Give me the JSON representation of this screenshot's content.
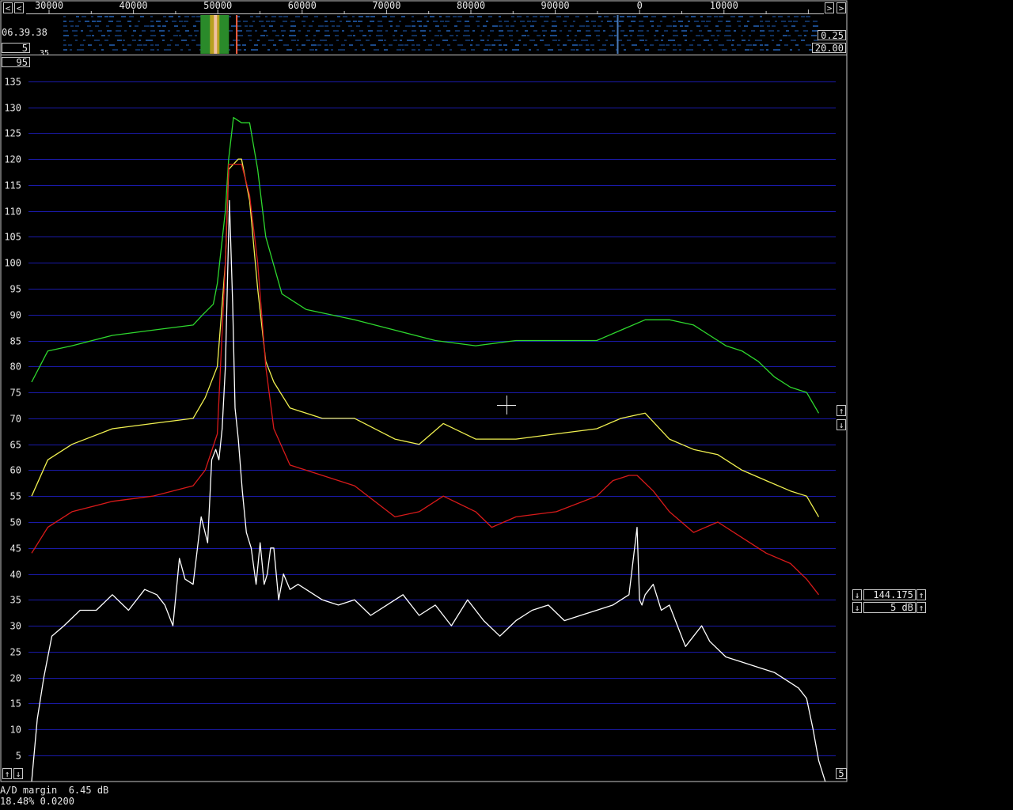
{
  "ruler": {
    "labels": [
      "30000",
      "40000",
      "50000",
      "60000",
      "70000",
      "80000",
      "90000",
      "0",
      "10000"
    ],
    "left_arrow": "<",
    "right_arrow": ">",
    "corner_arrow": ">"
  },
  "waterfall": {
    "time": "06.39.38",
    "avg": "5",
    "truncated_label": "35",
    "gain": "0.25",
    "zero": "20.00"
  },
  "main": {
    "top_value": "95",
    "up_arrow": "↑",
    "down_arrow": "↓",
    "bottom_right_value": "5"
  },
  "freq_panel": {
    "frequency": "144.175",
    "db_per_div": "5 dB",
    "down_arrow": "↓",
    "up_arrow": "↑"
  },
  "status": {
    "line1": "A/D margin  6.45 dB",
    "line2": "18.48% 0.0200"
  },
  "colors": {
    "grid": "#1a1aa8",
    "green_trace": "#2ed82e",
    "yellow_trace": "#f0f050",
    "red_trace": "#d81a1a",
    "white_trace": "#ffffff",
    "background": "#000000"
  },
  "chart_data": {
    "type": "line",
    "y_tick_labels": [
      "135",
      "130",
      "125",
      "120",
      "115",
      "110",
      "105",
      "100",
      "95",
      "90",
      "85",
      "80",
      "75",
      "70",
      "65",
      "60",
      "55",
      "50",
      "45",
      "40",
      "35",
      "30",
      "25",
      "20",
      "15",
      "10",
      "5"
    ],
    "ylim": [
      0,
      138
    ],
    "x_tick_labels": [
      "30000",
      "40000",
      "50000",
      "60000",
      "70000",
      "80000",
      "90000",
      "0",
      "10000"
    ],
    "grid": true,
    "series": [
      {
        "color": "green",
        "x": [
          0,
          2,
          5,
          10,
          15,
          20,
          21.2,
          22.5,
          23,
          24,
          24.4,
          25,
          26,
          27,
          28,
          29,
          31,
          34,
          37,
          40,
          45,
          50,
          55,
          60,
          65,
          70,
          73,
          76,
          79,
          82,
          84,
          86,
          88,
          90,
          92,
          94,
          96,
          97.5
        ],
        "y": [
          77,
          83,
          84,
          86,
          87,
          88,
          90,
          92,
          96,
          110,
          120,
          128,
          127,
          127,
          118,
          105,
          94,
          91,
          90,
          89,
          87,
          85,
          84,
          85,
          85,
          85,
          87,
          89,
          89,
          88,
          86,
          84,
          83,
          81,
          78,
          76,
          75,
          71
        ]
      },
      {
        "color": "yellow",
        "x": [
          0,
          2,
          5,
          10,
          15,
          20,
          21.5,
          23,
          24,
          24.4,
          25.6,
          26,
          27,
          28,
          29,
          30,
          32,
          36,
          40,
          45,
          48,
          51,
          55,
          60,
          65,
          70,
          73,
          76,
          79,
          82,
          85,
          88,
          91,
          94,
          96,
          97.5
        ],
        "y": [
          55,
          62,
          65,
          68,
          69,
          70,
          74,
          80,
          100,
          118,
          120,
          120,
          112,
          95,
          81,
          77,
          72,
          70,
          70,
          66,
          65,
          69,
          66,
          66,
          67,
          68,
          70,
          71,
          66,
          64,
          63,
          60,
          58,
          56,
          55,
          51
        ]
      },
      {
        "color": "red",
        "x": [
          0,
          2,
          5,
          10,
          15,
          20,
          21.5,
          23,
          24,
          24.4,
          26,
          27,
          28,
          29,
          30,
          32,
          36,
          40,
          45,
          48,
          51,
          55,
          57,
          60,
          65,
          70,
          72,
          74,
          75,
          77,
          79,
          82,
          85,
          88,
          91,
          94,
          96,
          97.5
        ],
        "y": [
          44,
          49,
          52,
          54,
          55,
          57,
          60,
          67,
          100,
          119,
          119,
          113,
          100,
          80,
          68,
          61,
          59,
          57,
          51,
          52,
          55,
          52,
          49,
          51,
          52,
          55,
          58,
          59,
          59,
          56,
          52,
          48,
          50,
          47,
          44,
          42,
          39,
          36
        ]
      },
      {
        "color": "white",
        "x": [
          0,
          0.7,
          1.5,
          2.5,
          4,
          6,
          8,
          10,
          12,
          14,
          15.5,
          16.5,
          17.5,
          18.3,
          19,
          20,
          21,
          21.8,
          22.3,
          22.8,
          23.2,
          23.6,
          24,
          24.5,
          24.9,
          25.2,
          25.6,
          26.1,
          26.6,
          27.2,
          27.8,
          28.3,
          28.8,
          29.2,
          29.6,
          30,
          30.6,
          31.2,
          32,
          33,
          34,
          36,
          38,
          40,
          42,
          44,
          46,
          48,
          50,
          52,
          54,
          56,
          58,
          60,
          62,
          64,
          66,
          68,
          70,
          72,
          74,
          75,
          75.3,
          75.6,
          76,
          77,
          78,
          79,
          80,
          81,
          82,
          83,
          84,
          86,
          88,
          90,
          92,
          94,
          95,
          96,
          96.8,
          97.5,
          98.3
        ],
        "y": [
          0,
          12,
          20,
          28,
          30,
          33,
          33,
          36,
          33,
          37,
          36,
          34,
          30,
          43,
          39,
          38,
          51,
          46,
          62,
          64,
          62,
          68,
          80,
          112,
          92,
          72,
          66,
          56,
          48,
          45,
          38,
          46,
          38,
          40,
          45,
          45,
          35,
          40,
          37,
          38,
          37,
          35,
          34,
          35,
          32,
          34,
          36,
          32,
          34,
          30,
          35,
          31,
          28,
          31,
          33,
          34,
          31,
          32,
          33,
          34,
          36,
          49,
          35,
          34,
          36,
          38,
          33,
          34,
          30,
          26,
          28,
          30,
          27,
          24,
          23,
          22,
          21,
          19,
          18,
          16,
          10,
          4,
          0
        ]
      }
    ],
    "waterfall_peak_x": [
      21.5,
      25.4,
      72.5
    ]
  }
}
